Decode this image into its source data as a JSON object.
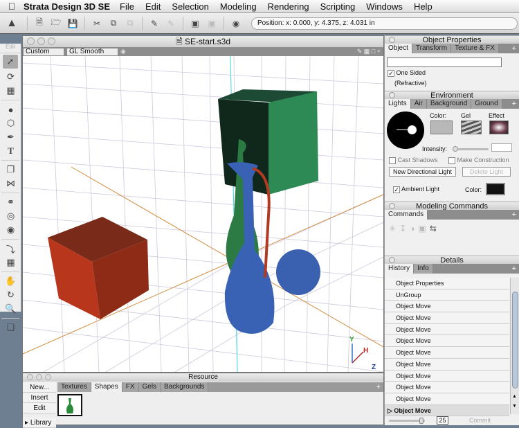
{
  "menubar": {
    "apple": "",
    "app": "Strata Design 3D SE",
    "items": [
      "File",
      "Edit",
      "Selection",
      "Modeling",
      "Rendering",
      "Scripting",
      "Windows",
      "Help"
    ]
  },
  "toolbar": {
    "position": "Position:  x: 0.000,  y: 4.375,  z: 4.031 in",
    "icons": [
      "shapes-icon",
      "new-icon",
      "open-icon",
      "save-icon",
      "cut-icon",
      "copy-icon",
      "paste-icon",
      "brush-icon",
      "eraser-icon",
      "render-icon",
      "render-region-icon",
      "preview-icon"
    ]
  },
  "tools": {
    "edit_label": "Edit",
    "items": [
      "select-arrow",
      "rotate",
      "group",
      "sphere",
      "polygon",
      "pen",
      "text",
      "extrude",
      "mirror",
      "light-bulb",
      "spotlight",
      "camera",
      "path",
      "grid",
      "hand",
      "move-view",
      "zoom",
      "object-props"
    ]
  },
  "document": {
    "title": "SE-start.s3d",
    "view_preset": "Custom",
    "render_mode": "GL Smooth"
  },
  "viewport": {
    "axes": {
      "y": "Y",
      "x": "H",
      "z": "Z"
    }
  },
  "object_properties": {
    "title": "Object Properties",
    "tabs": [
      "Object",
      "Transform",
      "Texture & FX"
    ],
    "active_tab": "Object",
    "name_value": "",
    "one_sided_label": "One Sided",
    "one_sided_checked": true,
    "refractive_label": "(Refractive)"
  },
  "environment": {
    "title": "Environment",
    "tabs": [
      "Lights",
      "Air",
      "Background",
      "Ground"
    ],
    "active_tab": "Lights",
    "color_label": "Color:",
    "gel_label": "Gel",
    "effect_label": "Effect",
    "intensity_label": "Intensity:",
    "intensity_value": "",
    "intensity_level": 0.05,
    "cast_shadows_label": "Cast Shadows",
    "make_construction_label": "Make Construction",
    "new_light_button": "New Directional Light",
    "delete_light_button": "Delete Light",
    "ambient_label": "Ambient Light",
    "ambient_checked": true,
    "ambient_color_label": "Color:",
    "ambient_color": "#111111"
  },
  "modeling_commands": {
    "title": "Modeling Commands",
    "tabs": [
      "Commands"
    ],
    "icons": [
      "explode-icon",
      "lathe-icon",
      "sphere-cmd-icon",
      "bevel-icon",
      "flip-icon"
    ]
  },
  "details": {
    "title": "Details",
    "tabs": [
      "History",
      "Info"
    ],
    "active_tab": "History",
    "history": [
      "Object Properties",
      "UnGroup",
      "Object Move",
      "Object Move",
      "Object Move",
      "Object Move",
      "Object Move",
      "Object Move",
      "Object Move",
      "Object Move",
      "Object Move",
      "Object Move"
    ],
    "current": "Object Move",
    "undo_levels": "25",
    "commit_label": "Commit"
  },
  "resource": {
    "title": "Resource",
    "buttons": [
      "New...",
      "Insert",
      "Edit"
    ],
    "library_label": "Library",
    "tabs": [
      "Textures",
      "Shapes",
      "FX",
      "Gels",
      "Backgrounds"
    ],
    "active_tab": "Shapes"
  }
}
